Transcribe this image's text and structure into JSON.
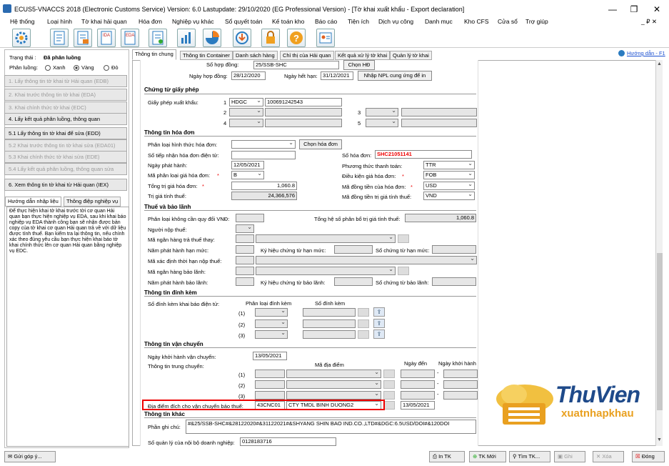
{
  "window": {
    "title": "ECUS5-VNACCS 2018 (Electronic Customs Service) Version: 6.0 Lastupdate: 29/10/2020 (EG Professional Version) - [Tờ khai xuất khẩu - Export declaration]",
    "minimize": "—",
    "maximize": "❐",
    "close": "✕"
  },
  "menu": [
    "Hệ thống",
    "Loại hình",
    "Tờ khai hải quan",
    "Hóa đơn",
    "Nghiệp vụ khác",
    "Sổ quyết toán",
    "Kế toán kho",
    "Báo cáo",
    "Tiện ích",
    "Dịch vụ công",
    "Danh mục",
    "Kho CFS",
    "Cửa sổ",
    "Trợ giúp"
  ],
  "menu_right": "_ ₽ ✕",
  "left": {
    "status_label": "Trạng thái :",
    "status_value": "Đã phân luồng",
    "lane_label": "Phân luồng:",
    "lane_green": "Xanh",
    "lane_yellow": "Vàng",
    "lane_red": "Đỏ",
    "steps": [
      "1. Lấy thông tin tờ khai từ Hải quan (EDB)",
      "2. Khai trước thông tin tờ khai (EDA)",
      "3. Khai chính thức tờ khai (EDC)",
      "4. Lấy kết quả phân luồng, thông quan",
      "5.1 Lấy thông tin tờ khai để sửa (EDD)",
      "5.2 Khai trước thông tin tờ khai sửa (EDA01)",
      "5.3 Khai chính thức tờ khai sửa (EDE)",
      "5.4 Lấy kết quả phân luồng, thông quan sửa",
      "6. Xem thông tin tờ khai từ Hải quan (IEX)"
    ],
    "tab1": "Hướng dẫn nhập liệu",
    "tab2": "Thông điệp nghiệp vụ",
    "help": "Để thực hiện khai tờ khai trước tời cơ quan Hải quan bạn thực hiện nghiệp vụ EDA, sau khi khai báo nghiệp vụ EDA thành công bạn sẽ nhận được bản copy của tờ khai cơ quan Hải quan trả về với dữ liệu được tính thuế. Bạn kiểm tra lại thông tin, nếu chính xác theo đúng yêu cầu bạn thực hiện khai báo tờ khai chính thức lên cơ quan Hải quan bằng nghiệp vụ EDC."
  },
  "tabs": [
    "Thông tin chung",
    "Thông tin Container",
    "Danh sách hàng",
    "Chỉ thị của Hải quan",
    "Kết quả xử lý tờ khai",
    "Quản lý tờ khai"
  ],
  "help_link": "Hướng dẫn - F1",
  "contract": {
    "so_label": "Số hợp đồng:",
    "so_value": "25/SSB-SHC",
    "chon_hd": "Chọn HĐ",
    "ngay_label": "Ngày hợp đồng:",
    "ngay_value": "28/12/2020",
    "het_han_label": "Ngày hết hạn:",
    "het_han_value": "31/12/2021",
    "nhap_npl": "Nhập NPL cung ứng để in"
  },
  "permit": {
    "title": "Chứng từ giấy phép",
    "label": "Giấy phép xuất khẩu:",
    "n1": "1",
    "n2": "2",
    "n3": "3",
    "n4": "4",
    "n5": "5",
    "code1": "HDGC",
    "num1": "100691242543"
  },
  "invoice": {
    "title": "Thông tin hóa đơn",
    "phan_loai_label": "Phân loại hình thức hóa đơn:",
    "chon_hd": "Chọn hóa đơn",
    "so_tiep_nhan_label": "Số tiếp nhận hóa đơn điện tử:",
    "so_hd_label": "Số hóa đơn:",
    "so_hd_value": "SHC21051141",
    "ngay_ph_label": "Ngày phát hành:",
    "ngay_ph_value": "12/05/2021",
    "pttt_label": "Phương thức thanh toán:",
    "pttt_value": "TTR",
    "ma_pl_label": "Mã phân loại giá hóa đơn:",
    "ma_pl_value": "B",
    "dkgh_label": "Điều kiện giá hóa đơn:",
    "dkgh_value": "FOB",
    "tong_tg_label": "Tổng trị giá hóa đơn:",
    "tong_tg_value": "1,060.8",
    "ma_tt_label": "Mã đồng tiền của hóa đơn:",
    "ma_tt_value": "USD",
    "tg_tinh_thue_label": "Trị giá tính thuế:",
    "tg_tinh_thue_value": "24,366,576",
    "ma_tt_tt_label": "Mã đồng tiền trị giá tính thuế:",
    "ma_tt_tt_value": "VND"
  },
  "tax": {
    "title": "Thuế và bảo lãnh",
    "pl_khong_label": "Phân loại không cần quy đổi VNĐ:",
    "tong_he_so_label": "Tổng hệ số phân bổ trị giá tính thuế:",
    "tong_he_so_value": "1,060.8",
    "nguoi_nop_label": "Người nộp thuế:",
    "ma_ngan_hang_label": "Mã ngân hàng trả thuế thay:",
    "nam_ph_label": "Năm phát hành hạn mức:",
    "ky_hieu_label": "Ký hiệu chứng từ hạn mức:",
    "so_ct_label": "Số chứng từ hạn mức:",
    "ma_xd_label": "Mã xác định thời hạn nộp thuế:",
    "ma_nh_bl_label": "Mã ngân hàng bảo lãnh:",
    "nam_bl_label": "Năm phát hành bảo lãnh:",
    "ky_hieu_bl_label": "Ký hiệu chứng từ bảo lãnh:",
    "so_ct_bl_label": "Số chứng từ bảo lãnh:"
  },
  "attach": {
    "title": "Thông tin đính kèm",
    "label": "Số đính kèm khai báo điện tử:",
    "col1": "Phân loại đính kèm",
    "col2": "Số đính kèm",
    "r1": "(1)",
    "r2": "(2)",
    "r3": "(3)"
  },
  "transport": {
    "title": "Thông tin vận chuyển",
    "ngay_kh_label": "Ngày khởi hành vận chuyển:",
    "ngay_kh_value": "13/05/2021",
    "trung_chuyen_label": "Thông tin trung chuyển:",
    "col_dia_diem": "Mã địa điểm",
    "col_ngay_den": "Ngày đến",
    "col_ngay_kh": "Ngày khởi hành",
    "r1": "(1)",
    "r2": "(2)",
    "r3": "(3)",
    "dich_label": "Địa điểm đích cho vận chuyển bảo thuế:",
    "dich_code": "43CNC01",
    "dich_name": "CTY TMDL BINH DUONG2",
    "dich_date": "13/05/2021"
  },
  "other": {
    "title": "Thông tin khác",
    "ghi_chu_label": "Phần ghi chú:",
    "ghi_chu_value": "#&25/SSB-SHC#&28122020#&31122021#&SHYANG SHIN BAO IND.CO.,LTD#&DGC:6.5USD/DOI#&120DOI",
    "so_ql_label": "Số quản lý của nội bộ doanh nghiệp:",
    "so_ql_value": "0128183716"
  },
  "statusbar": {
    "feedback": "Gửi góp ý...",
    "in_tk": "In TK",
    "tk_moi": "TK Mới",
    "tim_tk": "Tìm TK...",
    "ghi": "Ghi",
    "xoa": "Xóa",
    "dong": "Đóng"
  },
  "logo": {
    "line1": "ThuVien",
    "line2": "xuatnhapkhau"
  }
}
